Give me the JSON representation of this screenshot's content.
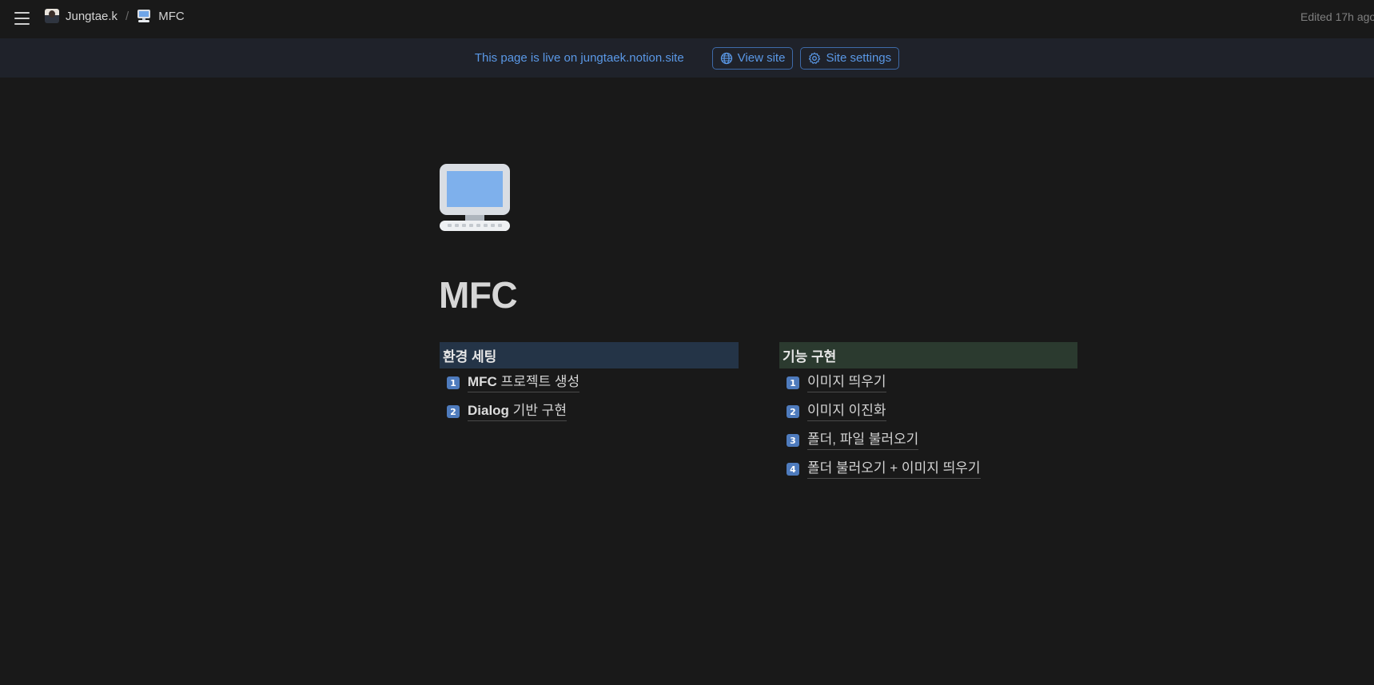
{
  "topbar": {
    "breadcrumbs": [
      {
        "label": "Jungtae.k",
        "icon": "avatar"
      },
      {
        "label": "MFC",
        "icon": "computer-icon"
      }
    ],
    "separator": "/",
    "edited": "Edited 17h ago"
  },
  "banner": {
    "text": "This page is live on jungtaek.notion.site",
    "view_site": "View site",
    "site_settings": "Site settings",
    "accent_color": "#5a98e6"
  },
  "page": {
    "icon": "desktop-computer-icon",
    "title": "MFC"
  },
  "columns": [
    {
      "header": "환경 세팅",
      "header_color": "#243447",
      "items": [
        {
          "num": "1",
          "bold": "MFC",
          "rest": " 프로젝트 생성"
        },
        {
          "num": "2",
          "bold": "Dialog",
          "rest": " 기반 구현"
        }
      ]
    },
    {
      "header": "기능 구현",
      "header_color": "#2b3a2f",
      "items": [
        {
          "num": "1",
          "bold": "",
          "rest": "이미지 띄우기"
        },
        {
          "num": "2",
          "bold": "",
          "rest": "이미지 이진화"
        },
        {
          "num": "3",
          "bold": "",
          "rest": "폴더, 파일 불러오기"
        },
        {
          "num": "4",
          "bold": "",
          "rest": "폴더 불러오기 + 이미지 띄우기"
        }
      ]
    }
  ]
}
